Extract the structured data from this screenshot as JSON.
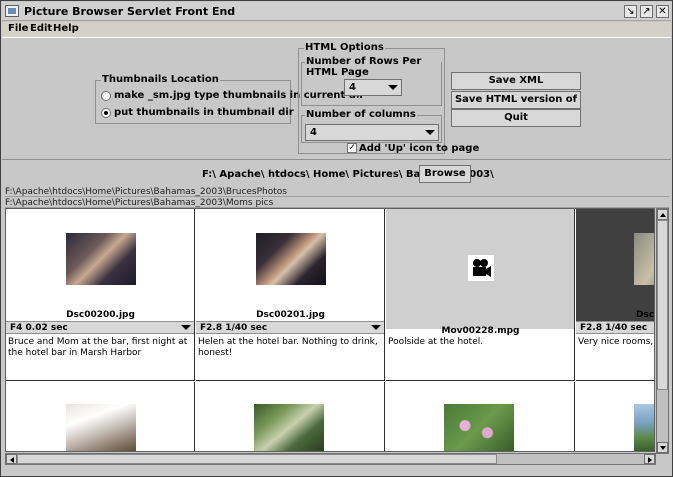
{
  "window": {
    "title": "Picture Browser Servlet Front End"
  },
  "menu": [
    "File",
    "Edit",
    "Help"
  ],
  "thumbnails": {
    "title": "Thumbnails Location",
    "option1": "make _sm.jpg type thumbnails in current dir",
    "option2": "put thumbnails in thumbnail dir",
    "selected": "option2"
  },
  "html_options": {
    "title": "HTML Options",
    "rows_label": "Number of Rows Per HTML Page",
    "rows_value": "4",
    "cols_label": "Number of columns",
    "cols_value": "4",
    "add_up_label": "Add 'Up' icon to page",
    "add_up_checked": true
  },
  "buttons": {
    "save_xml": "Save XML",
    "save_html": "Save HTML version of page",
    "quit": "Quit",
    "browse": "Browse"
  },
  "path": "F:\\ Apache\\ htdocs\\ Home\\ Pictures\\ Bahamas_2003\\",
  "subdirs": [
    "F:\\Apache\\htdocs\\Home\\Pictures\\Bahamas_2003\\BrucesPhotos",
    "F:\\Apache\\htdocs\\Home\\Pictures\\Bahamas_2003\\Moms pics"
  ],
  "cells": [
    {
      "file": "Dsc00200.jpg",
      "exif": "F4  0.02 sec",
      "desc": "Bruce and Mom at the bar, first night at the hotel bar in Marsh Harbor"
    },
    {
      "file": "Dsc00201.jpg",
      "exif": "F2.8  1/40 sec",
      "desc": "Helen at the hotel bar. Nothing to drink, honest!"
    },
    {
      "file": "Mov00228.mpg",
      "exif": "",
      "desc": "Poolside at the hotel."
    },
    {
      "file": "Dsc",
      "exif": "F2.8  1/40 sec",
      "desc": "Very nice rooms, com Marsh Harbor"
    }
  ]
}
